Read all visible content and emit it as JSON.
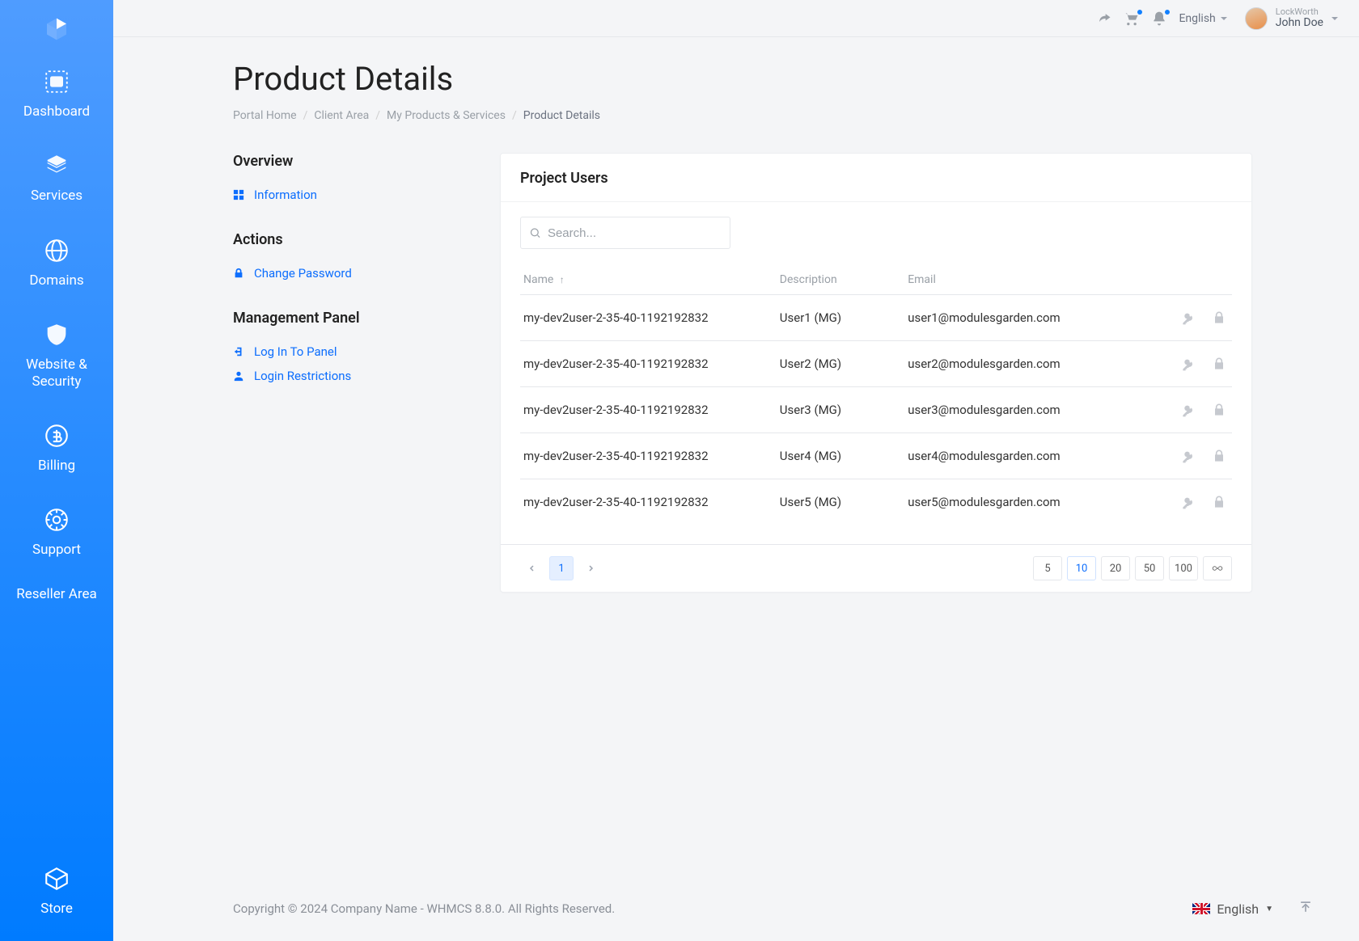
{
  "sidebar": {
    "items": [
      {
        "label": "Dashboard"
      },
      {
        "label": "Services"
      },
      {
        "label": "Domains"
      },
      {
        "label": "Website & Security"
      },
      {
        "label": "Billing"
      },
      {
        "label": "Support"
      },
      {
        "label": "Reseller Area"
      }
    ],
    "store": {
      "label": "Store"
    }
  },
  "topbar": {
    "language": "English",
    "user_company": "LockWorth",
    "user_name": "John Doe"
  },
  "page": {
    "title": "Product Details",
    "breadcrumb": {
      "items": [
        "Portal Home",
        "Client Area",
        "My Products & Services"
      ],
      "current": "Product Details"
    }
  },
  "sidepanel": {
    "overview": {
      "title": "Overview",
      "information": "Information"
    },
    "actions": {
      "title": "Actions",
      "change_password": "Change Password"
    },
    "management": {
      "title": "Management Panel",
      "login_to_panel": "Log In To Panel",
      "login_restrictions": "Login Restrictions"
    }
  },
  "card": {
    "title": "Project Users",
    "search_placeholder": "Search...",
    "columns": {
      "name": "Name",
      "description": "Description",
      "email": "Email"
    },
    "rows": [
      {
        "name": "my-dev2user-2-35-40-1192192832",
        "desc": "User1 (MG)",
        "email": "user1@modulesgarden.com"
      },
      {
        "name": "my-dev2user-2-35-40-1192192832",
        "desc": "User2 (MG)",
        "email": "user2@modulesgarden.com"
      },
      {
        "name": "my-dev2user-2-35-40-1192192832",
        "desc": "User3 (MG)",
        "email": "user3@modulesgarden.com"
      },
      {
        "name": "my-dev2user-2-35-40-1192192832",
        "desc": "User4 (MG)",
        "email": "user4@modulesgarden.com"
      },
      {
        "name": "my-dev2user-2-35-40-1192192832",
        "desc": "User5 (MG)",
        "email": "user5@modulesgarden.com"
      }
    ],
    "pagination": {
      "current_page": "1",
      "page_sizes": [
        "5",
        "10",
        "20",
        "50",
        "100"
      ],
      "active_size": "10"
    }
  },
  "footer": {
    "copyright": "Copyright © 2024 Company Name - WHMCS 8.8.0. All Rights Reserved.",
    "language": "English"
  }
}
